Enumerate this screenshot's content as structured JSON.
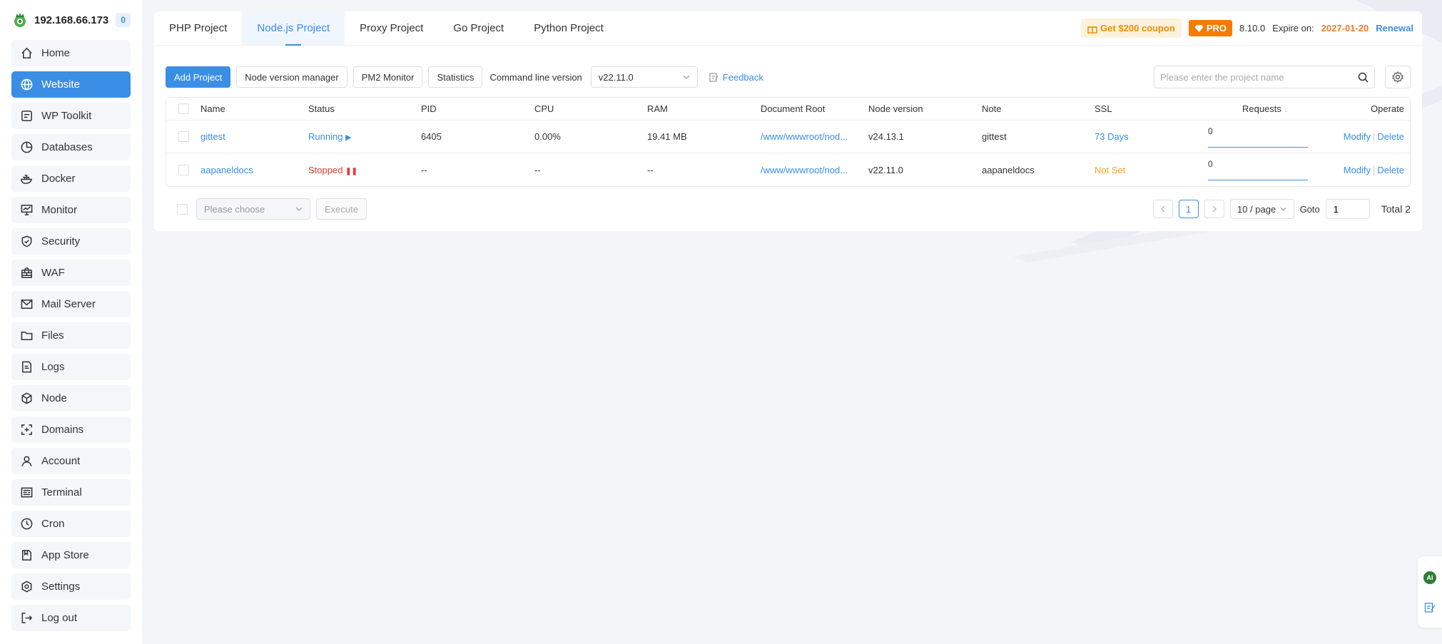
{
  "sidebar": {
    "server_ip": "192.168.66.173",
    "badge_count": "0",
    "items": [
      {
        "label": "Home",
        "icon": "home-icon"
      },
      {
        "label": "Website",
        "icon": "globe-icon",
        "active": true
      },
      {
        "label": "WP Toolkit",
        "icon": "wordpress-icon"
      },
      {
        "label": "Databases",
        "icon": "database-icon"
      },
      {
        "label": "Docker",
        "icon": "docker-icon"
      },
      {
        "label": "Monitor",
        "icon": "monitor-icon"
      },
      {
        "label": "Security",
        "icon": "shield-icon"
      },
      {
        "label": "WAF",
        "icon": "firewall-icon"
      },
      {
        "label": "Mail Server",
        "icon": "mail-icon"
      },
      {
        "label": "Files",
        "icon": "folder-icon"
      },
      {
        "label": "Logs",
        "icon": "log-icon"
      },
      {
        "label": "Node",
        "icon": "node-icon"
      },
      {
        "label": "Domains",
        "icon": "domain-icon"
      },
      {
        "label": "Account",
        "icon": "user-icon"
      },
      {
        "label": "Terminal",
        "icon": "terminal-icon"
      },
      {
        "label": "Cron",
        "icon": "clock-icon"
      },
      {
        "label": "App Store",
        "icon": "store-icon"
      },
      {
        "label": "Settings",
        "icon": "gear-icon"
      },
      {
        "label": "Log out",
        "icon": "logout-icon"
      }
    ]
  },
  "tabs": [
    "PHP Project",
    "Node.js Project",
    "Proxy Project",
    "Go Project",
    "Python Project"
  ],
  "active_tab": "Node.js Project",
  "header_right": {
    "coupon": "Get $200 coupon",
    "pro": "PRO",
    "version": "8.10.0",
    "expire_label": "Expire on:",
    "expire_date": "2027-01-20",
    "renewal": "Renewal"
  },
  "toolbar": {
    "add_project": "Add Project",
    "node_version_manager": "Node version manager",
    "pm2_monitor": "PM2 Monitor",
    "statistics": "Statistics",
    "cmd_label": "Command line version",
    "cmd_version": "v22.11.0",
    "feedback": "Feedback",
    "search_placeholder": "Please enter the project name"
  },
  "table": {
    "headers": {
      "name": "Name",
      "status": "Status",
      "pid": "PID",
      "cpu": "CPU",
      "ram": "RAM",
      "doc_root": "Document Root",
      "node_version": "Node version",
      "note": "Note",
      "ssl": "SSL",
      "requests": "Requests",
      "operate": "Operate"
    },
    "rows": [
      {
        "name": "gittest",
        "status": "Running",
        "pid": "6405",
        "cpu": "0.00%",
        "ram": "19.41 MB",
        "doc_root": "/www/wwwroot/nod...",
        "node_version": "v24.13.1",
        "note": "gittest",
        "ssl": "73 Days",
        "requests": "0",
        "modify": "Modify",
        "delete": "Delete"
      },
      {
        "name": "aapaneldocs",
        "status": "Stopped",
        "pid": "--",
        "cpu": "--",
        "ram": "--",
        "doc_root": "/www/wwwroot/nod...",
        "node_version": "v22.11.0",
        "note": "aapaneldocs",
        "ssl": "Not Set",
        "requests": "0",
        "modify": "Modify",
        "delete": "Delete"
      }
    ]
  },
  "footer": {
    "batch_placeholder": "Please choose",
    "execute": "Execute",
    "current_page": "1",
    "per_page": "10 / page",
    "goto_label": "Goto",
    "goto_value": "1",
    "total": "Total 2"
  },
  "dock": {
    "ai": "AI"
  },
  "colors": {
    "accent": "#3a8ee6",
    "running": "#3a8ee6",
    "stopped": "#e53935",
    "warning": "#f5a623",
    "pro": "#f57c00"
  }
}
